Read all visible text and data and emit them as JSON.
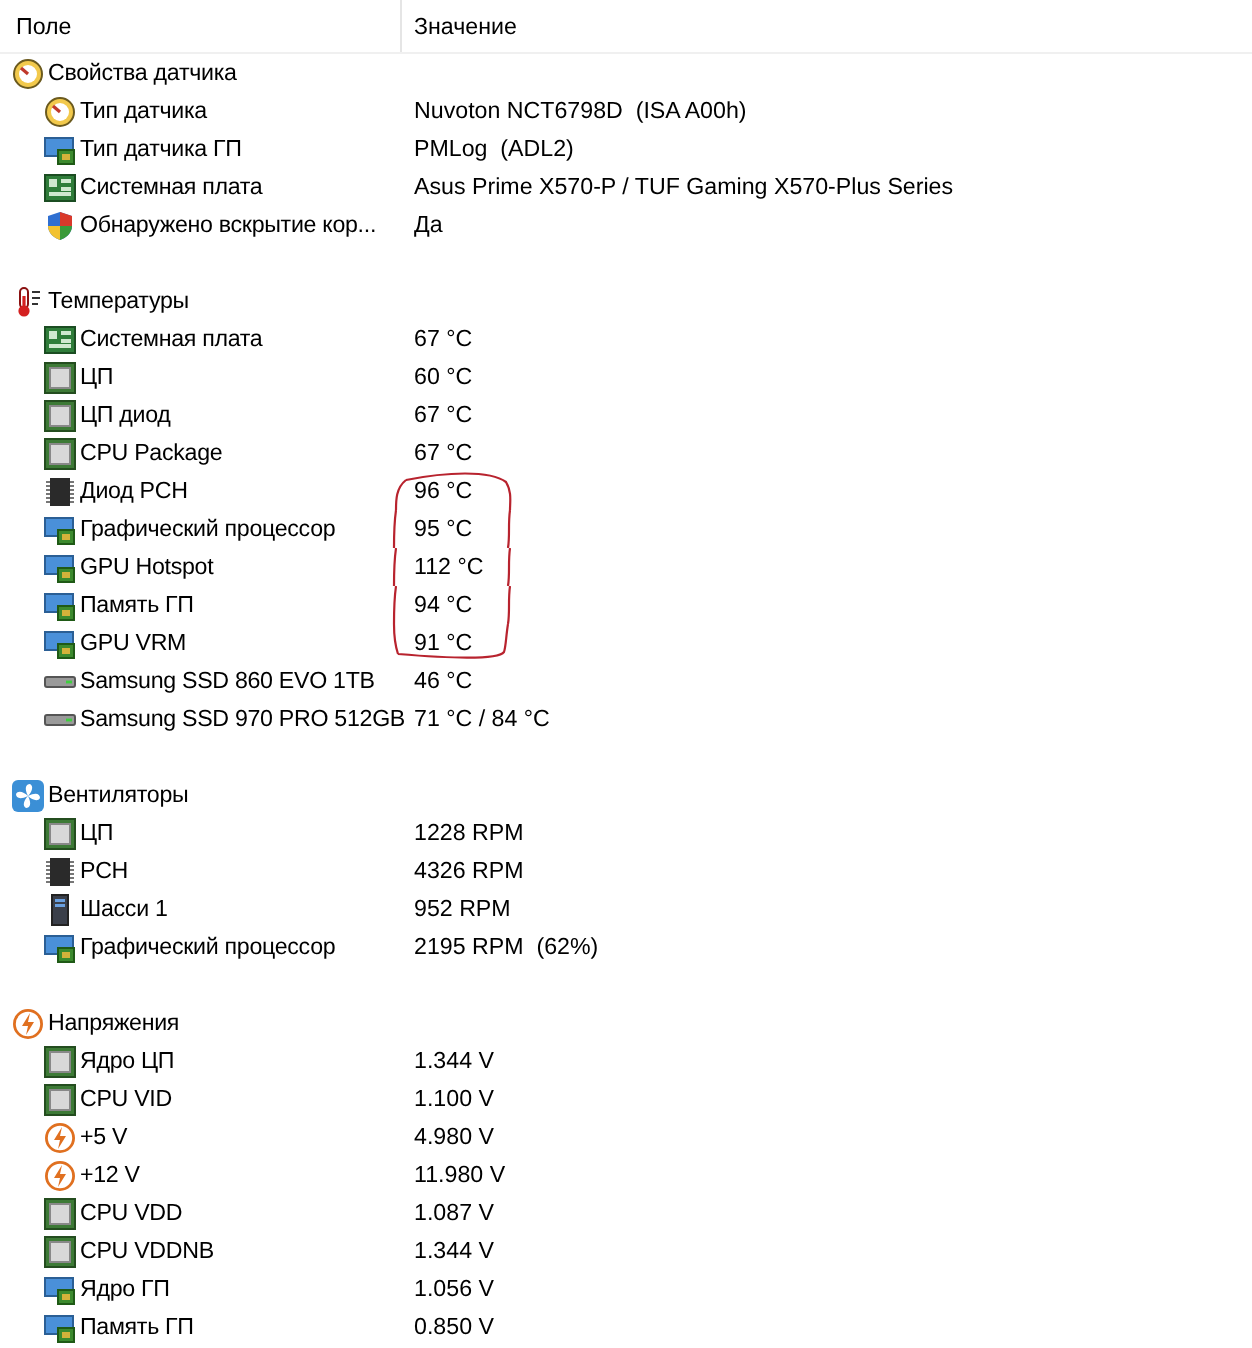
{
  "columns": [
    "Поле",
    "Значение"
  ],
  "sections": [
    {
      "title": "Свойства датчика",
      "kind": "gauge",
      "items": [
        {
          "label": "Тип датчика",
          "value": "Nuvoton NCT6798D  (ISA A00h)",
          "kind": "gauge",
          "circled": false
        },
        {
          "label": "Тип датчика ГП",
          "value": "PMLog  (ADL2)",
          "kind": "gpu",
          "circled": false
        },
        {
          "label": "Системная плата",
          "value": "Asus Prime X570-P / TUF Gaming X570-Plus Series",
          "kind": "board",
          "circled": false
        },
        {
          "label": "Обнаружено вскрытие кор...",
          "value": "Да",
          "kind": "shield",
          "circled": false
        }
      ]
    },
    {
      "title": "Температуры",
      "kind": "thermo",
      "items": [
        {
          "label": "Системная плата",
          "value": "67 °C",
          "kind": "board",
          "circled": false
        },
        {
          "label": "ЦП",
          "value": "60 °C",
          "kind": "cpu",
          "circled": false
        },
        {
          "label": "ЦП диод",
          "value": "67 °C",
          "kind": "cpu",
          "circled": false
        },
        {
          "label": "CPU Package",
          "value": "67 °C",
          "kind": "cpu",
          "circled": false
        },
        {
          "label": "Диод PCH",
          "value": "96 °C",
          "kind": "chip",
          "circled": true
        },
        {
          "label": "Графический процессор",
          "value": "95 °C",
          "kind": "gpu",
          "circled": true
        },
        {
          "label": "GPU Hotspot",
          "value": "112 °C",
          "kind": "gpu",
          "circled": true
        },
        {
          "label": "Память ГП",
          "value": "94 °C",
          "kind": "gpu",
          "circled": true
        },
        {
          "label": "GPU VRM",
          "value": "91 °C",
          "kind": "gpu",
          "circled": true
        },
        {
          "label": "Samsung SSD 860 EVO 1TB",
          "value": "46 °C",
          "kind": "ssd",
          "circled": false
        },
        {
          "label": "Samsung SSD 970 PRO 512GB",
          "value": "71 °C / 84 °C",
          "kind": "ssd",
          "circled": false
        }
      ]
    },
    {
      "title": "Вентиляторы",
      "kind": "fan",
      "items": [
        {
          "label": "ЦП",
          "value": "1228 RPM",
          "kind": "cpu",
          "circled": false
        },
        {
          "label": "PCH",
          "value": "4326 RPM",
          "kind": "chip",
          "circled": false
        },
        {
          "label": "Шасси 1",
          "value": "952 RPM",
          "kind": "case",
          "circled": false
        },
        {
          "label": "Графический процессор",
          "value": "2195 RPM  (62%)",
          "kind": "gpu",
          "circled": false
        }
      ]
    },
    {
      "title": "Напряжения",
      "kind": "volt",
      "items": [
        {
          "label": "Ядро ЦП",
          "value": "1.344 V",
          "kind": "cpu",
          "circled": false
        },
        {
          "label": "CPU VID",
          "value": "1.100 V",
          "kind": "cpu",
          "circled": false
        },
        {
          "label": "+5 V",
          "value": "4.980 V",
          "kind": "volt",
          "circled": false
        },
        {
          "label": "+12 V",
          "value": "11.980 V",
          "kind": "volt",
          "circled": false
        },
        {
          "label": "CPU VDD",
          "value": "1.087 V",
          "kind": "cpu",
          "circled": false
        },
        {
          "label": "CPU VDDNB",
          "value": "1.344 V",
          "kind": "cpu",
          "circled": false
        },
        {
          "label": "Ядро ГП",
          "value": "1.056 V",
          "kind": "gpu",
          "circled": false
        },
        {
          "label": "Память ГП",
          "value": "0.850 V",
          "kind": "gpu",
          "circled": false
        }
      ]
    }
  ]
}
